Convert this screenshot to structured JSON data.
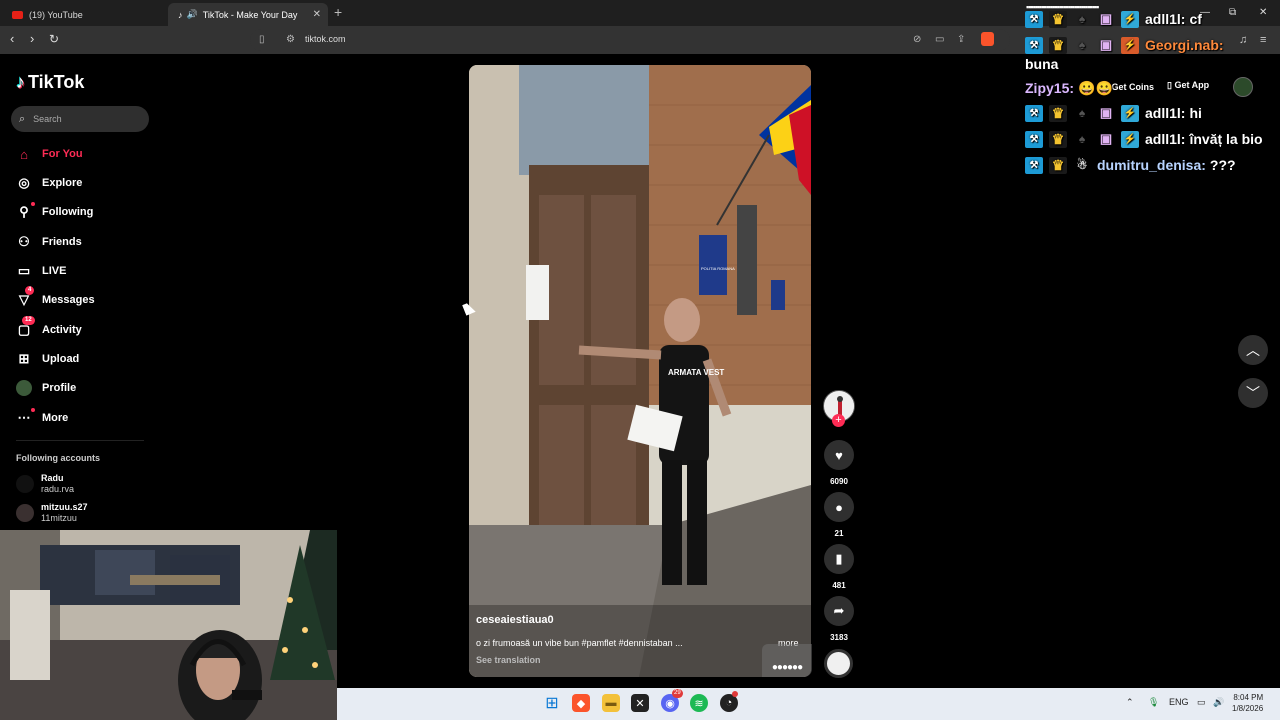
{
  "browser": {
    "tabs": [
      {
        "label": "(19) YouTube",
        "fav_color": "#e62117"
      },
      {
        "label": "TikTok - Make Your Day",
        "fav_color": "#ffffff"
      }
    ],
    "new_tab": "+",
    "url": "tiktok.com"
  },
  "tiktok": {
    "logo_text": "TikTok",
    "search_placeholder": "Search",
    "menu": [
      {
        "label": "For You",
        "icon": "home-icon",
        "active": true
      },
      {
        "label": "Explore",
        "icon": "compass-icon"
      },
      {
        "label": "Following",
        "icon": "person-icon",
        "dot": true
      },
      {
        "label": "Friends",
        "icon": "people-icon"
      },
      {
        "label": "LIVE",
        "icon": "live-icon"
      },
      {
        "label": "Messages",
        "icon": "send-icon",
        "badge": "4"
      },
      {
        "label": "Activity",
        "icon": "inbox-icon",
        "badge": "12"
      },
      {
        "label": "Upload",
        "icon": "plus-square-icon"
      },
      {
        "label": "Profile",
        "icon": "avatar-icon"
      },
      {
        "label": "More",
        "icon": "dots-icon",
        "dot": true
      }
    ],
    "following_title": "Following accounts",
    "accounts": [
      {
        "name": "Radu",
        "handle": "radu.rva"
      },
      {
        "name": "mitzuu.s27",
        "handle": "11mitzuu"
      }
    ],
    "header": {
      "get_coins": "Get Coins",
      "get_app": "Get App"
    }
  },
  "video": {
    "username": "ceseaiestiaua0",
    "description": "o zi frumoasă un vibe bun #pamflet #dennistaban ...",
    "more": "more",
    "see_translation": "See translation",
    "likes": "6090",
    "comments": "21",
    "saves": "481",
    "shares": "3183",
    "shirt_text": "ARMATA VEST",
    "sign_text": "POLITIA ROMANA"
  },
  "chat": {
    "lines": [
      {
        "user": "adll1l:",
        "msg": "cf",
        "user_color": "#ffffff",
        "badges": [
          "mod",
          "vip",
          "drop",
          "gift",
          "tw"
        ]
      },
      {
        "user": "Georgi.nab:",
        "msg": "",
        "user_color": "#ff8a3c",
        "badges": [
          "mod",
          "vip",
          "drop",
          "gift",
          "tw2"
        ]
      },
      {
        "user": "",
        "msg": "buna",
        "user_color": "#ffffff",
        "badges": []
      },
      {
        "user": "Zipy15:",
        "msg": "",
        "user_color": "#dbb8ff",
        "badges": []
      },
      {
        "user": "adll1l:",
        "msg": "hi",
        "user_color": "#ffffff",
        "badges": [
          "mod",
          "vip",
          "drop",
          "gift",
          "tw"
        ]
      },
      {
        "user": "adll1l:",
        "msg": "învăț la bio",
        "user_color": "#ffffff",
        "badges": [
          "mod",
          "vip",
          "drop",
          "gift",
          "tw"
        ]
      },
      {
        "user": "dumitru_denisa:",
        "msg": "???",
        "user_color": "#b8d4ff",
        "badges": [
          "mod",
          "vip",
          "drop"
        ]
      }
    ]
  },
  "taskbar": {
    "discord_badge": "29",
    "lang": "ENG",
    "time": "8:04 PM",
    "date": "1/8/2026"
  },
  "colors": {
    "accent": "#fe2c55",
    "taskbar": "#e7ecf3",
    "chrome": "#333333"
  }
}
